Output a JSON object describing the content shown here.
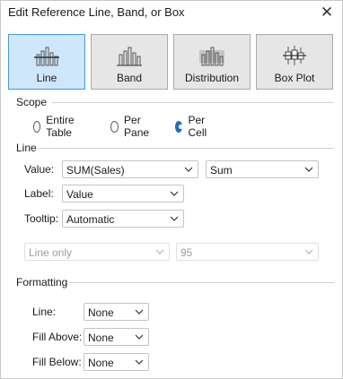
{
  "window": {
    "title": "Edit Reference Line, Band, or Box",
    "close_icon": "close-icon"
  },
  "types": [
    {
      "label": "Line",
      "icon": "reference-line-icon",
      "selected": true
    },
    {
      "label": "Band",
      "icon": "reference-band-icon",
      "selected": false
    },
    {
      "label": "Distribution",
      "icon": "distribution-icon",
      "selected": false
    },
    {
      "label": "Box Plot",
      "icon": "box-plot-icon",
      "selected": false
    }
  ],
  "scope": {
    "title": "Scope",
    "options": [
      {
        "label": "Entire Table",
        "selected": false
      },
      {
        "label": "Per Pane",
        "selected": false
      },
      {
        "label": "Per Cell",
        "selected": true
      }
    ]
  },
  "line": {
    "title": "Line",
    "value_label": "Value:",
    "value_field": "SUM(Sales)",
    "aggregation": "Sum",
    "label_label": "Label:",
    "label_value": "Value",
    "tooltip_label": "Tooltip:",
    "tooltip_value": "Automatic",
    "interval_mode": "Line only",
    "confidence": "95"
  },
  "formatting": {
    "title": "Formatting",
    "line_label": "Line:",
    "line_value": "None",
    "fill_above_label": "Fill Above:",
    "fill_above_value": "None",
    "fill_below_label": "Fill Below:",
    "fill_below_value": "None"
  },
  "colors": {
    "accent": "#1f6fbf",
    "selected_bg": "#cfe7fb",
    "selected_border": "#4a97d7"
  }
}
